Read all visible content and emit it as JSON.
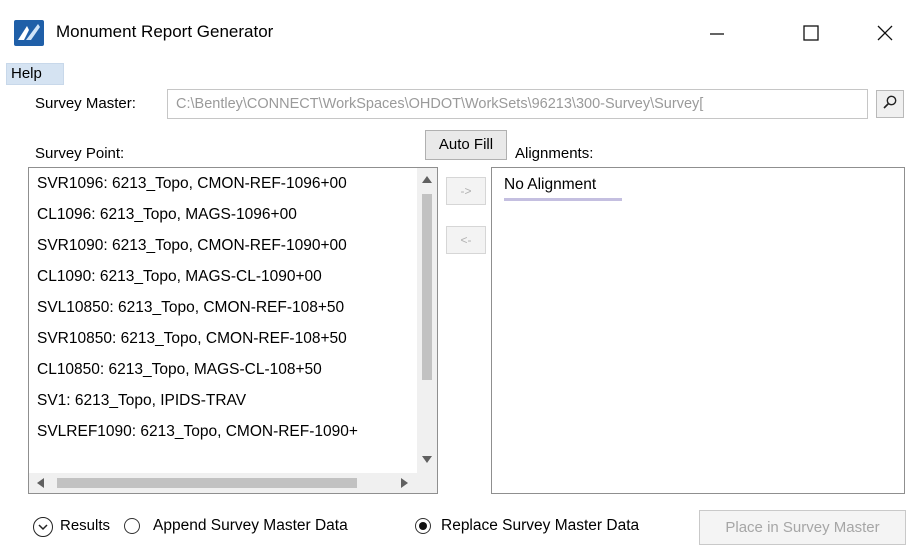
{
  "window": {
    "title": "Monument Report Generator",
    "icon": "bentley-app-icon",
    "controls": [
      "minimize-icon",
      "maximize-icon",
      "close-icon"
    ]
  },
  "menu": {
    "help": "Help"
  },
  "survey_master": {
    "label": "Survey Master:",
    "path": "C:\\Bentley\\CONNECT\\WorkSpaces\\OHDOT\\WorkSets\\96213\\300-Survey\\Survey[",
    "browse_icon": "search-icon"
  },
  "survey_point": {
    "label": "Survey Point:",
    "items": [
      "SVR1096: 6213_Topo, CMON-REF-1096+00",
      "CL1096: 6213_Topo, MAGS-1096+00",
      "SVR1090: 6213_Topo, CMON-REF-1090+00",
      "CL1090: 6213_Topo, MAGS-CL-1090+00",
      "SVL10850: 6213_Topo, CMON-REF-108+50",
      "SVR10850: 6213_Topo, CMON-REF-108+50",
      "CL10850: 6213_Topo, MAGS-CL-108+50",
      "SV1: 6213_Topo, IPIDS-TRAV",
      "SVLREF1090: 6213_Topo, CMON-REF-1090+"
    ]
  },
  "auto_fill": "Auto Fill",
  "move_right": "->",
  "move_left": "<-",
  "alignments": {
    "label": "Alignments:",
    "items": [
      "No Alignment"
    ]
  },
  "footer": {
    "results": "Results",
    "append": "Append Survey Master Data",
    "replace": "Replace Survey Master Data",
    "selected_option": "replace",
    "place_button": "Place in Survey Master"
  },
  "colors": {
    "menu_highlight": "#d5e3f2",
    "disabled_text": "#a6a6a6",
    "alignment_underline": "#c4bfe0"
  }
}
